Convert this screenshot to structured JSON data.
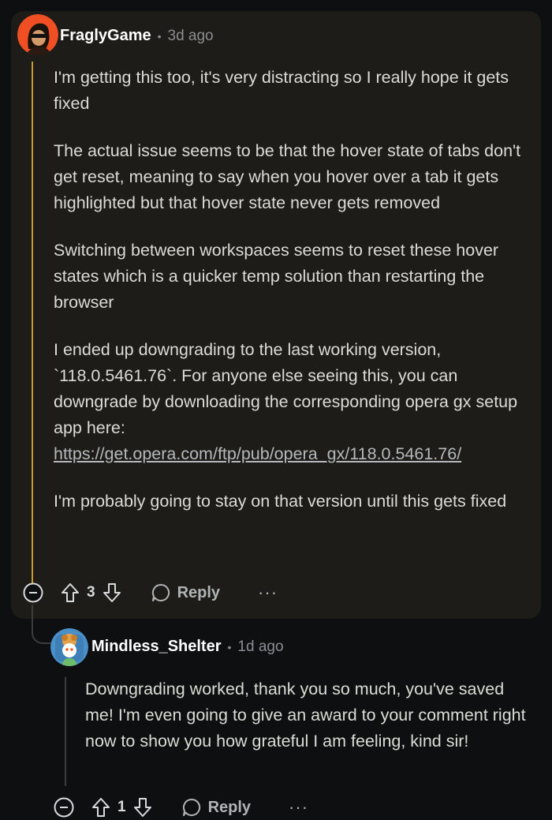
{
  "comments": [
    {
      "author": "FraglyGame",
      "time": "3d ago",
      "paragraphs": [
        "I'm getting this too, it's very distracting so I really hope it gets fixed",
        "The actual issue seems to be that the hover state of tabs don't get reset, meaning to say when you hover over a tab it gets highlighted but that hover state never gets removed",
        "Switching between workspaces seems to reset these hover states which is a quicker temp solution than restarting the browser",
        "I ended up downgrading to the last working version, `118.0.5461.76`. For anyone else seeing this, you can downgrade by downloading the corresponding opera gx setup app here:",
        "I'm probably going to stay on that version until this gets fixed"
      ],
      "link": "https://get.opera.com/ftp/pub/opera_gx/118.0.5461.76/",
      "votes": "3",
      "reply_label": "Reply",
      "more_label": "···"
    },
    {
      "author": "Mindless_Shelter",
      "time": "1d ago",
      "paragraphs": [
        "Downgrading worked, thank you so much, you've saved me! I'm even going to give an award to your comment right now to show you how grateful I am feeling, kind sir!"
      ],
      "votes": "1",
      "reply_label": "Reply",
      "more_label": "···"
    }
  ],
  "colors": {
    "thread_highlight": "#c99b2b",
    "card_bg": "#1d1c18",
    "page_bg": "#0e0f11"
  }
}
